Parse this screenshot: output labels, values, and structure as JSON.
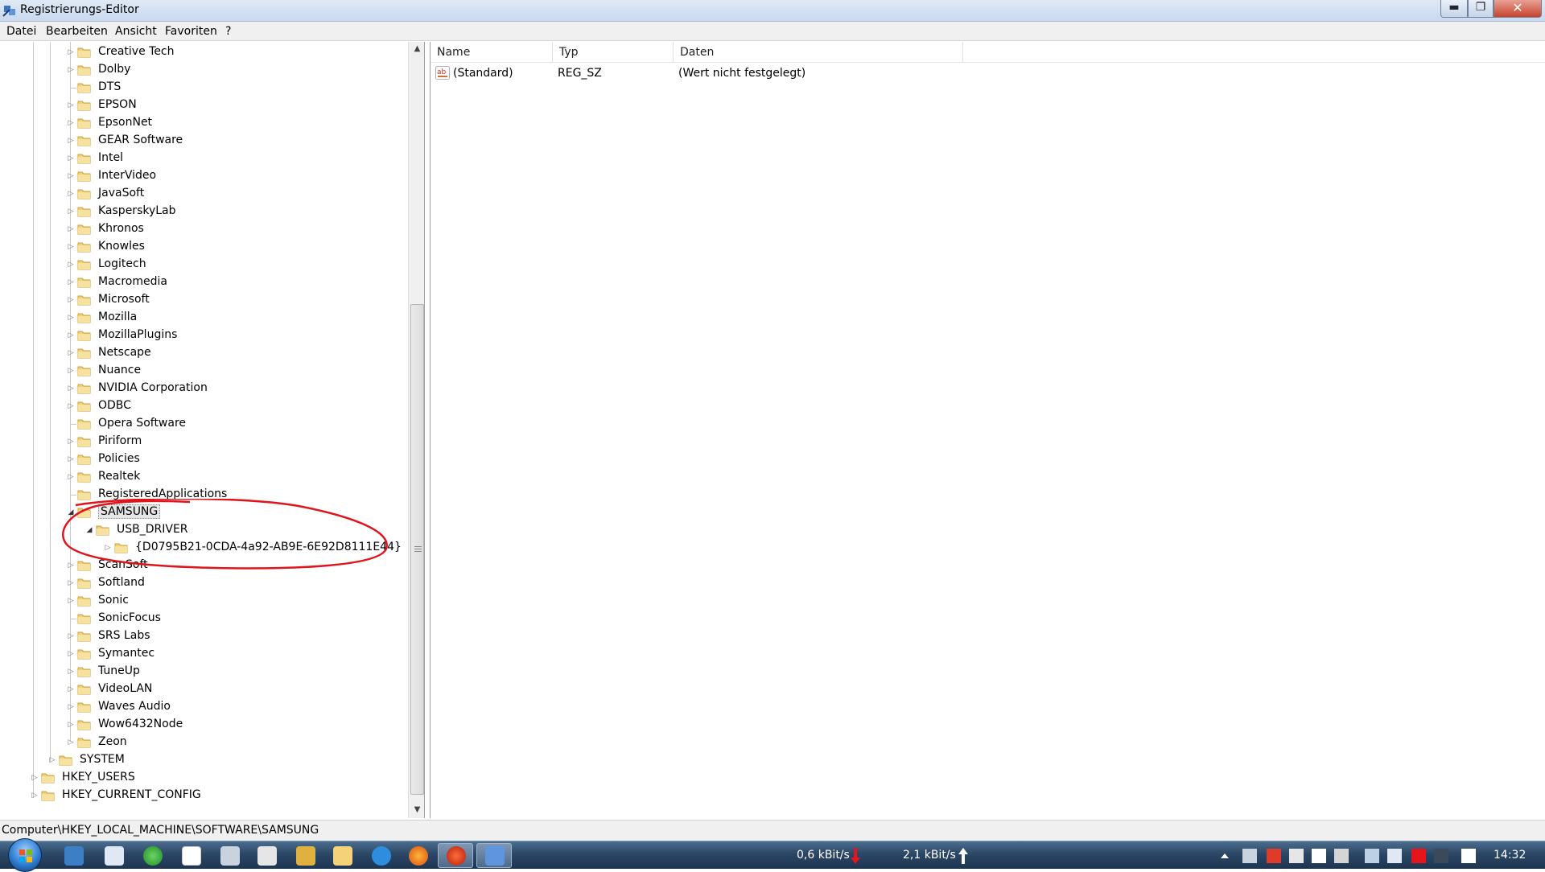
{
  "window": {
    "title": "Registrierungs-Editor",
    "min_glyph": "▬",
    "max_glyph": "❐",
    "close_glyph": "✕"
  },
  "menu": [
    "Datei",
    "Bearbeiten",
    "Ansicht",
    "Favoriten",
    "?"
  ],
  "tree": {
    "software_children": [
      {
        "label": "Creative Tech",
        "expandable": true
      },
      {
        "label": "Dolby",
        "expandable": true
      },
      {
        "label": "DTS",
        "expandable": false
      },
      {
        "label": "EPSON",
        "expandable": true
      },
      {
        "label": "EpsonNet",
        "expandable": true
      },
      {
        "label": "GEAR Software",
        "expandable": true
      },
      {
        "label": "Intel",
        "expandable": true
      },
      {
        "label": "InterVideo",
        "expandable": true
      },
      {
        "label": "JavaSoft",
        "expandable": true
      },
      {
        "label": "KasperskyLab",
        "expandable": true
      },
      {
        "label": "Khronos",
        "expandable": true
      },
      {
        "label": "Knowles",
        "expandable": true
      },
      {
        "label": "Logitech",
        "expandable": true
      },
      {
        "label": "Macromedia",
        "expandable": true
      },
      {
        "label": "Microsoft",
        "expandable": true
      },
      {
        "label": "Mozilla",
        "expandable": true
      },
      {
        "label": "MozillaPlugins",
        "expandable": true
      },
      {
        "label": "Netscape",
        "expandable": true
      },
      {
        "label": "Nuance",
        "expandable": true
      },
      {
        "label": "NVIDIA Corporation",
        "expandable": true
      },
      {
        "label": "ODBC",
        "expandable": true
      },
      {
        "label": "Opera Software",
        "expandable": false
      },
      {
        "label": "Piriform",
        "expandable": true
      },
      {
        "label": "Policies",
        "expandable": true
      },
      {
        "label": "Realtek",
        "expandable": true
      },
      {
        "label": "RegisteredApplications",
        "expandable": false
      },
      {
        "label": "SAMSUNG",
        "expandable": true,
        "expanded": true,
        "selected": true
      },
      {
        "label": "USB_DRIVER",
        "expandable": true,
        "expanded": true,
        "depth": 1
      },
      {
        "label": "{D0795B21-0CDA-4a92-AB9E-6E92D8111E44}",
        "expandable": true,
        "depth": 2
      },
      {
        "label": "ScanSoft",
        "expandable": true
      },
      {
        "label": "Softland",
        "expandable": true
      },
      {
        "label": "Sonic",
        "expandable": true
      },
      {
        "label": "SonicFocus",
        "expandable": false
      },
      {
        "label": "SRS Labs",
        "expandable": true
      },
      {
        "label": "Symantec",
        "expandable": true
      },
      {
        "label": "TuneUp",
        "expandable": true
      },
      {
        "label": "VideoLAN",
        "expandable": true
      },
      {
        "label": "Waves Audio",
        "expandable": true
      },
      {
        "label": "Wow6432Node",
        "expandable": true
      },
      {
        "label": "Zeon",
        "expandable": true
      }
    ],
    "system": "SYSTEM",
    "hkey_users": "HKEY_USERS",
    "hkey_current_config": "HKEY_CURRENT_CONFIG"
  },
  "values": {
    "columns": [
      "Name",
      "Typ",
      "Daten"
    ],
    "rows": [
      {
        "name": "(Standard)",
        "type": "REG_SZ",
        "data": "(Wert nicht festgelegt)",
        "icon": "string-value-icon"
      }
    ]
  },
  "statusbar": {
    "path": "Computer\\HKEY_LOCAL_MACHINE\\SOFTWARE\\SAMSUNG"
  },
  "taskbar": {
    "download_rate": "0,6 kBit/s",
    "upload_rate": "2,1 kBit/s",
    "clock": "14:32"
  },
  "colors": {
    "annotation": "#e0141b",
    "taskbar": "#2b4766",
    "selection": "#e6e6e6"
  }
}
